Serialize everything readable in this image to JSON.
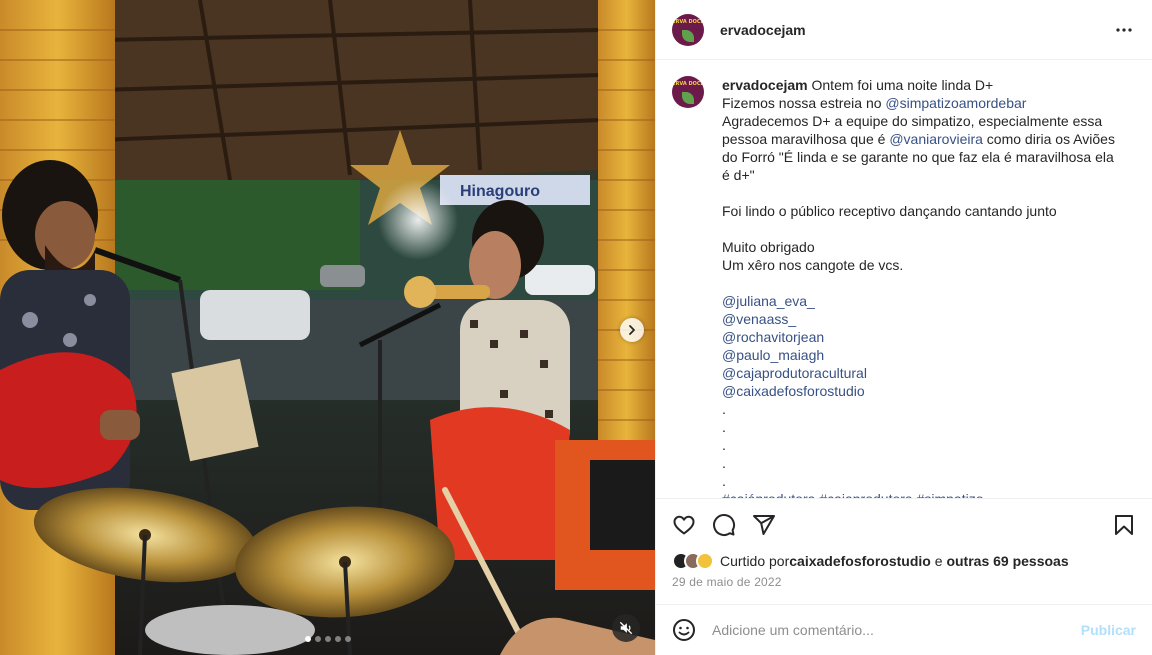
{
  "post": {
    "username": "ervadocejam",
    "avatar_text": "ERVA DOCE",
    "caption_lines": [
      {
        "type": "text",
        "text": "Fizemos nossa estreia no "
      },
      {
        "type": "text",
        "text": "Agradecemos D+ a equipe do simpatizo, especialmente essa pessoa maravilhosa que é "
      },
      {
        "type": "text",
        "text": " como diria os Aviões do Forró \"É linda e se garante no que faz ela é maravilhosa ela é d+\""
      }
    ],
    "caption_first_line": "Ontem foi uma noite linda D+",
    "caption_line2_prefix": "Fizemos nossa estreia no ",
    "caption_line2_mention": "@simpatizoamordebar",
    "caption_line3_prefix": "Agradecemos D+ a equipe do simpatizo, especialmente essa pessoa maravilhosa que é ",
    "caption_line3_mention": "@vaniarovieira",
    "caption_line3_suffix": " como diria os Aviões do Forró \"É linda e se garante no que faz ela é maravilhosa ela é d+\"",
    "caption_line4": "Foi lindo o público receptivo dançando cantando junto",
    "caption_line5": "Muito obrigado",
    "caption_line6": "Um xêro nos cangote de vcs.",
    "mentions": [
      "@juliana_eva_",
      "@venaass_",
      "@rochavitorjean",
      "@paulo_maiagh",
      "@cajaprodutoracultural",
      "@caixadefosforostudio"
    ],
    "dots_lines": [
      ".",
      ".",
      ".",
      ".",
      "."
    ],
    "hashtags": "#cajáprodutora #cajaprodutora #simpatizo"
  },
  "likes": {
    "prefix": "Curtido por ",
    "user": "caixadefosforostudio",
    "middle": " e ",
    "others": "outras 69 pessoas"
  },
  "date": "29 de maio de 2022",
  "comment_input": {
    "placeholder": "Adicione um comentário...",
    "value": ""
  },
  "publish_label": "Publicar",
  "media": {
    "carousel_count": 5,
    "active_index": 0,
    "sign_text": "Hinagouro"
  },
  "icons": {
    "more": "more-horizontal-icon",
    "like": "heart-icon",
    "comment": "comment-icon",
    "share": "paper-plane-icon",
    "save": "bookmark-icon",
    "emoji": "emoji-icon",
    "next": "chevron-right-icon",
    "mute": "muted-speaker-icon"
  },
  "colors": {
    "link": "#385185",
    "publish_disabled": "#b2dffc",
    "avatar_bg": "#6b1a4a"
  }
}
